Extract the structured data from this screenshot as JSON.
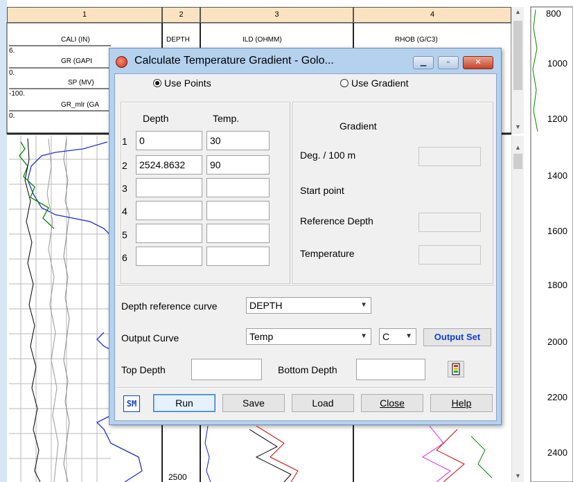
{
  "log_plot": {
    "tracks": [
      {
        "number": "1",
        "curves": [
          "CALI (IN)",
          "GR (GAPI",
          "SP (MV)",
          "GR_mlr (GA"
        ]
      },
      {
        "number": "2",
        "curves": [
          "DEPTH"
        ]
      },
      {
        "number": "3",
        "curves": [
          "ILD (OHMM)"
        ]
      },
      {
        "number": "4",
        "curves": [
          "RHOB (G/C3)"
        ]
      }
    ],
    "scale_values": [
      "6.",
      "0.",
      "-100.",
      "0."
    ],
    "track2_depth_label": "2500",
    "overview_depths": [
      "800",
      "1000",
      "1200",
      "1400",
      "1600",
      "1800",
      "2000",
      "2200",
      "2400"
    ]
  },
  "dialog": {
    "title": "Calculate Temperature Gradient - Golo...",
    "radio_use_points": "Use Points",
    "radio_use_gradient": "Use Gradient",
    "points_header_depth": "Depth",
    "points_header_temp": "Temp.",
    "points": [
      {
        "row": "1",
        "depth": "0",
        "temp": "30"
      },
      {
        "row": "2",
        "depth": "2524.8632",
        "temp": "90"
      },
      {
        "row": "3",
        "depth": "",
        "temp": ""
      },
      {
        "row": "4",
        "depth": "",
        "temp": ""
      },
      {
        "row": "5",
        "depth": "",
        "temp": ""
      },
      {
        "row": "6",
        "depth": "",
        "temp": ""
      }
    ],
    "gradient_title": "Gradient",
    "deg_per_100m_label": "Deg. / 100 m",
    "start_point_label": "Start point",
    "reference_depth_label": "Reference Depth",
    "temperature_label": "Temperature",
    "depth_ref_curve_label": "Depth reference curve",
    "depth_ref_curve_value": "DEPTH",
    "output_curve_label": "Output Curve",
    "output_curve_value": "Temp",
    "output_unit_value": "C",
    "output_set_label": "Output Set",
    "top_depth_label": "Top Depth",
    "bottom_depth_label": "Bottom Depth",
    "sm_logo": "SM",
    "buttons": {
      "run": "Run",
      "save": "Save",
      "load": "Load",
      "close": "Close",
      "help": "Help"
    }
  },
  "colors": {
    "title_bar": "#b4d1ee",
    "output_set": "#1040d0",
    "track_header": "#fbe3c1"
  }
}
